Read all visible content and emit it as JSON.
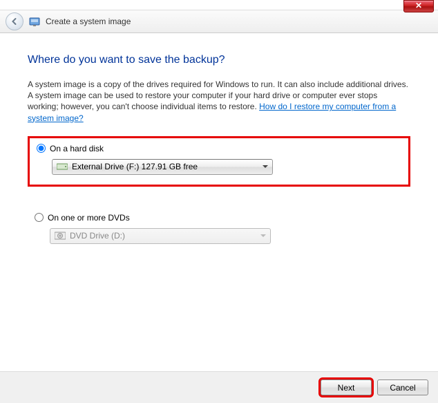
{
  "window": {
    "title": "Create a system image"
  },
  "heading": "Where do you want to save the backup?",
  "description": "A system image is a copy of the drives required for Windows to run. It can also include additional drives. A system image can be used to restore your computer if your hard drive or computer ever stops working; however, you can't choose individual items to restore. ",
  "help_link": "How do I restore my computer from a system image?",
  "options": {
    "hard_disk": {
      "label": "On a hard disk",
      "selected": "External Drive (F:)  127.91 GB free"
    },
    "dvd": {
      "label": "On one or more DVDs",
      "selected": "DVD Drive (D:)"
    }
  },
  "footer": {
    "next": "Next",
    "cancel": "Cancel"
  }
}
